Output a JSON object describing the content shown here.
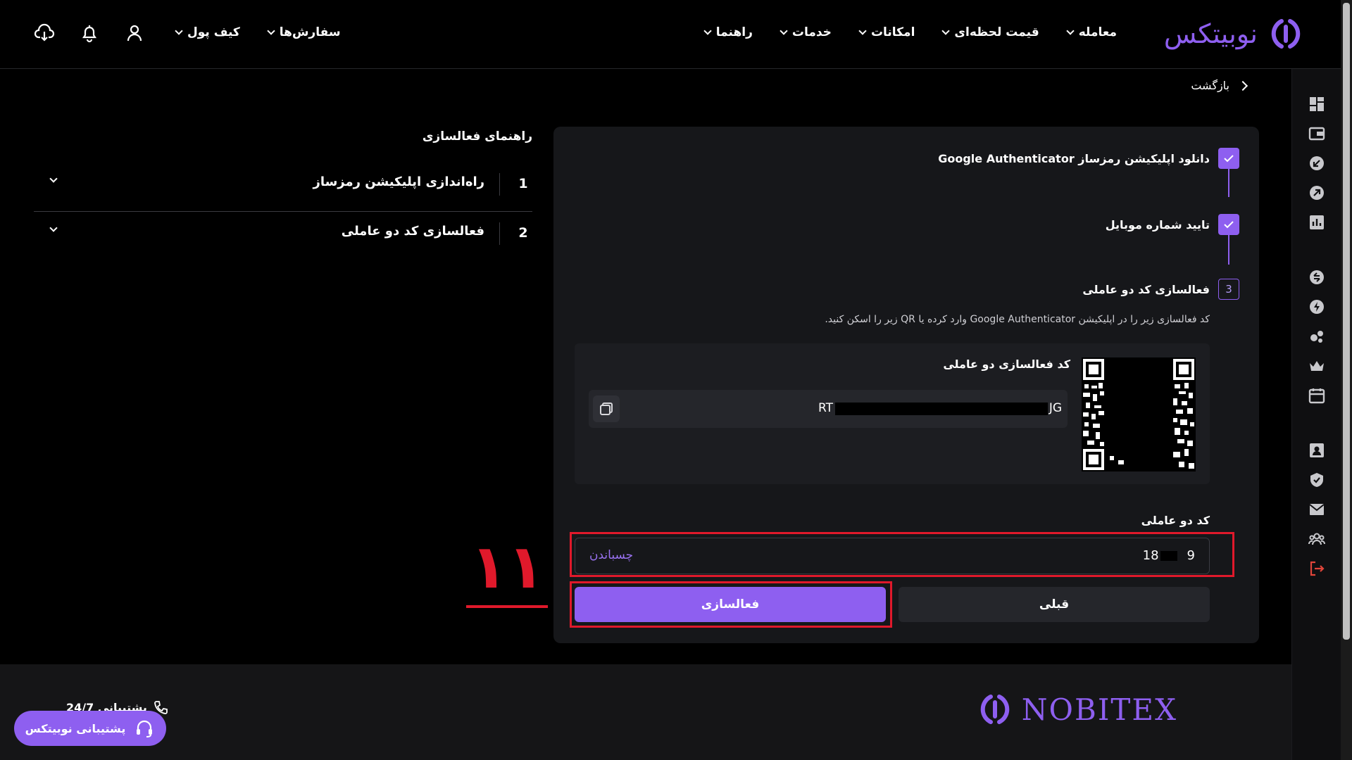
{
  "brand": {
    "name": "نوبیتکس",
    "footer_name": "NOBITEX",
    "accent": "#8e5ff0"
  },
  "nav": {
    "items": [
      "معامله",
      "قیمت لحظه‌ای",
      "امکانات",
      "خدمات",
      "راهنما"
    ],
    "left_items": [
      "سفارش‌ها",
      "کیف پول"
    ]
  },
  "back": {
    "label": "بازگشت"
  },
  "steps": [
    {
      "label": "دانلود اپلیکیشن رمزساز Google Authenticator",
      "status": "done"
    },
    {
      "label": "تایید شماره موبایل",
      "status": "done"
    },
    {
      "label": "فعالسازی کد دو عاملی",
      "status": "current",
      "number": "3"
    }
  ],
  "activation": {
    "instruction": "کد فعالسازی زیر را در اپلیکیشن Google Authenticator وارد کرده یا QR زیر را اسکن کنید.",
    "code_label": "کد فعالسازی دو عاملی",
    "code_start": "RT",
    "code_end": "JG"
  },
  "two_factor": {
    "label": "کد دو عاملی",
    "value_start": "18",
    "value_end": "9",
    "paste_label": "چسباندن"
  },
  "buttons": {
    "activate": "فعالسازی",
    "previous": "قبلی"
  },
  "guide": {
    "title": "راهنمای فعالسازی",
    "items": [
      {
        "number": "1",
        "title": "راه‌اندازی اپلیکیشن رمزساز"
      },
      {
        "number": "2",
        "title": "فعالسازی کد دو عاملی"
      }
    ]
  },
  "annotation": {
    "number": "١١",
    "color": "#e0192b"
  },
  "footer": {
    "phone_label": "پشتیبانی 24/7",
    "support_button": "پشتیبانی نوبیتکس"
  }
}
